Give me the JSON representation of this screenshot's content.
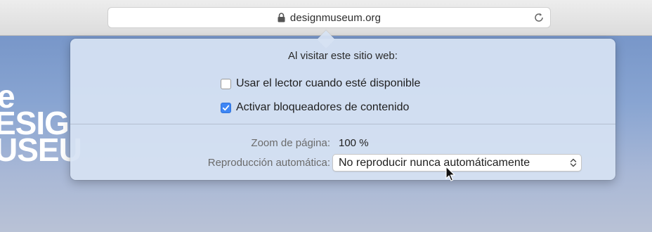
{
  "browser": {
    "url": "designmuseum.org",
    "lock_icon": "lock-icon",
    "reload_icon": "reload-icon"
  },
  "background_logo": {
    "lines": [
      "e",
      "ESIG",
      "USEU"
    ]
  },
  "popover": {
    "title": "Al visitar este sitio web:",
    "reader_option": {
      "label": "Usar el lector cuando esté disponible",
      "checked": false
    },
    "blockers_option": {
      "label": "Activar bloqueadores de contenido",
      "checked": true
    },
    "zoom_label": "Zoom de página:",
    "zoom_value": "100 %",
    "autoplay_label": "Reproducción automática:",
    "autoplay_value": "No reproducir nunca automáticamente"
  },
  "colors": {
    "accent": "#3e86f5",
    "popover_bg": "#d6e2f3",
    "label_gray": "#6b6b6b"
  }
}
